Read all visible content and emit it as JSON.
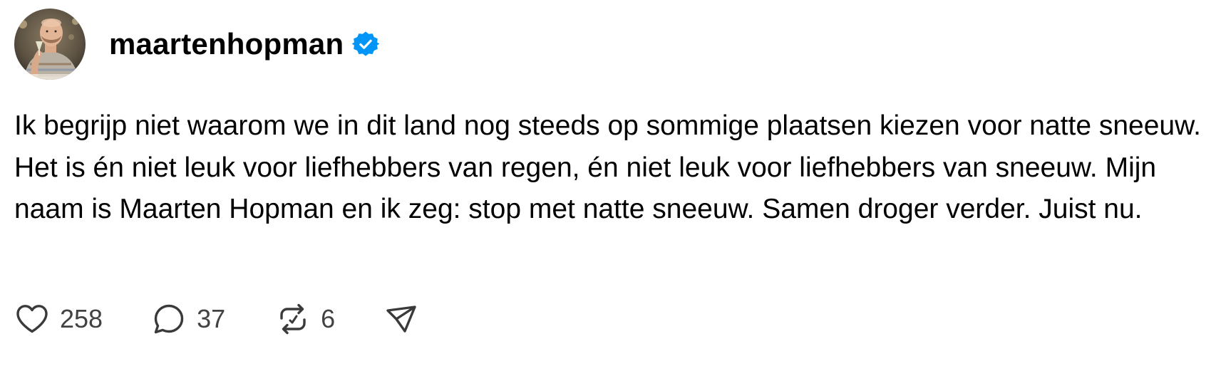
{
  "post": {
    "username": "maartenhopman",
    "verified_icon": "verified-badge-icon",
    "avatar_icon": "profile-photo",
    "text": "Ik begrijp niet waarom we in dit land nog steeds op sommige plaatsen kiezen voor natte sneeuw. Het is én niet leuk voor liefhebbers van regen, én niet leuk voor liefhebbers van sneeuw. Mijn naam is Maarten Hopman en ik zeg: stop met natte sneeuw. Samen droger verder. Juist nu."
  },
  "actions": {
    "like": {
      "icon": "heart-icon",
      "count": "258"
    },
    "reply": {
      "icon": "comment-icon",
      "count": "37"
    },
    "repost": {
      "icon": "repost-icon",
      "count": "6"
    },
    "share": {
      "icon": "send-icon"
    }
  },
  "colors": {
    "text": "#000000",
    "count": "#424242",
    "icon": "#3a3a3a",
    "verified": "#0095f6"
  }
}
